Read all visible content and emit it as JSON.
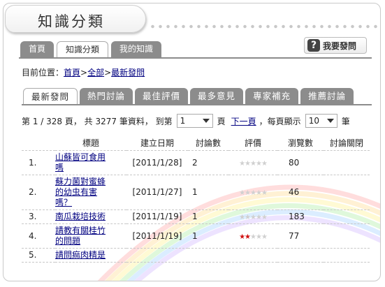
{
  "page_title": "知識分類",
  "top_tabs": [
    "首頁",
    "知識分類",
    "我的知識"
  ],
  "ask_button": {
    "label": "我要發問",
    "icon": "question-icon"
  },
  "breadcrumb": {
    "prefix": "目前位置：",
    "home": "首頁",
    "sep1": ">",
    "all": "全部",
    "sep2": ">",
    "current": "最新發問"
  },
  "sub_tabs": [
    "最新發問",
    "熱門討論",
    "最佳評價",
    "最多意見",
    "專家補充",
    "推薦討論"
  ],
  "pager": {
    "summary": "第 1 / 328 頁， 共 3277 筆資料， 到第",
    "page_value": "1",
    "page_unit": "頁",
    "next_link": "下一頁",
    "per_page_label": "，每頁顯示",
    "per_page_value": "10",
    "per_page_unit": "筆"
  },
  "table": {
    "headers": [
      "標題",
      "建立日期",
      "討論數",
      "評價",
      "瀏覽數",
      "討論關閉"
    ],
    "rows": [
      {
        "no": "1.",
        "title_lines": [
          "山蘇皆可食用",
          "嗎"
        ],
        "date": "[2011/1/28]",
        "discuss": "2",
        "rating": 0,
        "views": "80",
        "closed": ""
      },
      {
        "no": "2.",
        "title_lines": [
          "蘇力菌對蜜蜂",
          "的幼虫有害",
          "嗎？"
        ],
        "date": "[2011/1/27]",
        "discuss": "1",
        "rating": 0,
        "views": "46",
        "closed": ""
      },
      {
        "no": "3.",
        "title_lines": [
          "南瓜栽培技術"
        ],
        "date": "[2011/1/19]",
        "discuss": "1",
        "rating": 0,
        "views": "183",
        "closed": ""
      },
      {
        "no": "4.",
        "title_lines": [
          "請教有關桂竹",
          "的問題"
        ],
        "date": "[2011/1/19]",
        "discuss": "1",
        "rating": 2,
        "views": "77",
        "closed": ""
      },
      {
        "no": "5.",
        "title_lines": [
          "請問痲肉精是"
        ],
        "date": "",
        "discuss": "",
        "rating": 0,
        "views": "",
        "closed": ""
      }
    ]
  },
  "colors": {
    "tab_gray": "#8c8c8c",
    "link_blue": "#000080",
    "star_on": "#d01010",
    "star_off": "#d0d0d0"
  }
}
